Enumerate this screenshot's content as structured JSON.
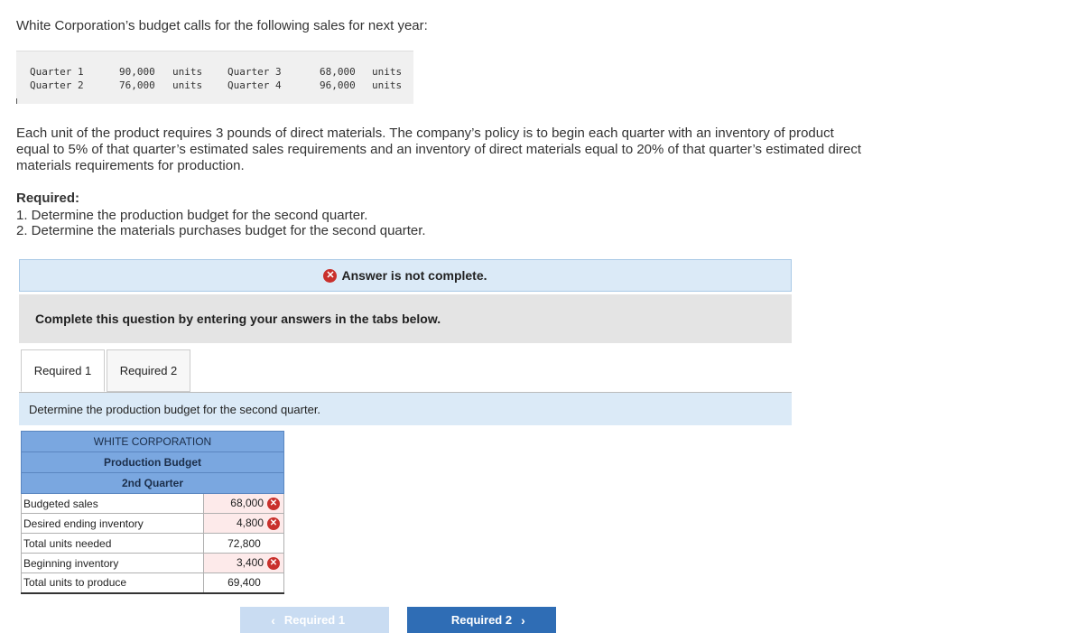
{
  "intro": "White Corporation’s budget calls for the following sales for next year:",
  "sales_table": {
    "rows": [
      {
        "q_a": "Quarter 1",
        "v_a": "90,000",
        "u_a": "units",
        "q_b": "Quarter 3",
        "v_b": "68,000",
        "u_b": "units"
      },
      {
        "q_a": "Quarter 2",
        "v_a": "76,000",
        "u_a": "units",
        "q_b": "Quarter 4",
        "v_b": "96,000",
        "u_b": "units"
      }
    ]
  },
  "paragraph": "Each unit of the product requires 3 pounds of direct materials. The company’s policy is to begin each quarter with an inventory of product equal to 5% of that quarter’s estimated sales requirements and an inventory of direct materials equal to 20% of that quarter’s estimated direct materials requirements for production.",
  "required": {
    "heading": "Required:",
    "items": [
      "1. Determine the production budget for the second quarter.",
      "2. Determine the materials purchases budget for the second quarter."
    ]
  },
  "status_banner": "Answer is not complete.",
  "instruction": "Complete this question by entering your answers in the tabs below.",
  "tabs": [
    {
      "label": "Required 1",
      "active": true
    },
    {
      "label": "Required 2",
      "active": false
    }
  ],
  "tab_description": "Determine the production budget for the second quarter.",
  "budget": {
    "company": "WHITE CORPORATION",
    "title": "Production Budget",
    "period": "2nd Quarter",
    "rows": [
      {
        "label": "Budgeted sales",
        "value": "68,000",
        "status": "incorrect"
      },
      {
        "label": "Desired ending inventory",
        "value": "4,800",
        "status": "incorrect"
      },
      {
        "label": "Total units needed",
        "value": "72,800",
        "status": "computed"
      },
      {
        "label": "Beginning inventory",
        "value": "3,400",
        "status": "incorrect"
      },
      {
        "label": "Total units to produce",
        "value": "69,400",
        "status": "computed"
      }
    ]
  },
  "nav": {
    "prev_label": "Required 1",
    "next_label": "Required 2"
  },
  "colors": {
    "banner_bg": "#dbeaf7",
    "header_blue": "#7aa7e0",
    "error_red": "#c9302c",
    "next_button": "#2f6db5",
    "prev_button_disabled": "#c9dcf2"
  },
  "icons": {
    "incorrect": "x-circle-icon",
    "prev": "chevron-left-icon",
    "next": "chevron-right-icon"
  }
}
